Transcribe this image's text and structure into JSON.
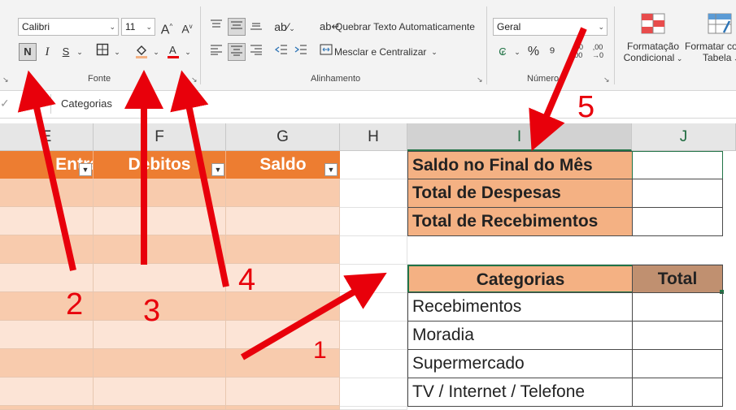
{
  "ribbon": {
    "font_name": "Calibri",
    "font_size": "11",
    "bold_label": "N",
    "italic_label": "I",
    "underline_label": "S",
    "font_group_label": "Fonte",
    "alignment_group_label": "Alinhamento",
    "number_group_label": "Número",
    "wrap_text_label": "Quebrar Texto Automaticamente",
    "merge_center_label": "Mesclar e Centralizar",
    "number_format": "Geral",
    "conditional_format_label_1": "Formatação",
    "conditional_format_label_2": "Condicional",
    "format_table_label_1": "Formatar co",
    "format_table_label_2": "Tabela",
    "fill_color": "#f4b183",
    "font_color": "#e8000b"
  },
  "formula_bar": {
    "content": "Categorias"
  },
  "columns": [
    "E",
    "F",
    "G",
    "H",
    "I",
    "J"
  ],
  "table_headers": {
    "entradas": "Entradas",
    "debitos": "Debitos",
    "saldo": "Saldo"
  },
  "summary": [
    "Saldo no Final do Mês",
    "Total de Despesas",
    "Total de Recebimentos"
  ],
  "category_table": {
    "header": "Categorias",
    "total_header": "Total",
    "items": [
      "Recebimentos",
      "Moradia",
      "Supermercado",
      "TV / Internet / Telefone"
    ]
  },
  "annotations": [
    "1",
    "2",
    "3",
    "4",
    "5"
  ],
  "colors": {
    "table_header": "#ed7d31",
    "band_light": "#fce4d6",
    "band_dark": "#f8cbad",
    "summary_fill": "#f4b183",
    "total_fill": "#c09070",
    "annotation": "#e8000b"
  }
}
